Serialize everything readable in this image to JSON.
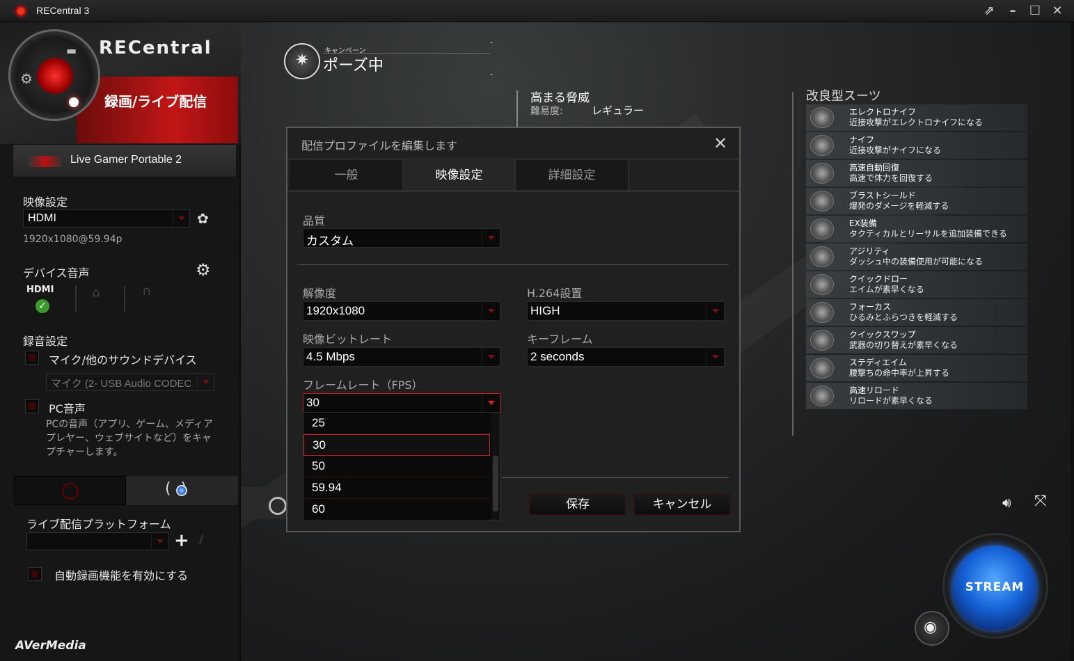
{
  "window": {
    "title": "RECentral 3",
    "controls": [
      "pin-icon",
      "minimize-icon",
      "maximize-icon",
      "close-icon"
    ]
  },
  "brand": {
    "logo_text": "RECentral",
    "mode": "録画/ライブ配信",
    "footer_logo": "AVerMedia"
  },
  "device": {
    "name": "Live Gamer Portable 2"
  },
  "video_settings": {
    "label": "映像設定",
    "source": "HDMI",
    "signal": "1920x1080@59.94p"
  },
  "device_audio": {
    "label": "デバイス音声",
    "sources": [
      {
        "label": "HDMI",
        "status": "check"
      }
    ]
  },
  "recording": {
    "label": "録音設定",
    "mic_label": "マイク/他のサウンドデバイス",
    "mic_device": "マイク (2- USB Audio CODEC",
    "pc_label": "PC音声",
    "pc_desc": "PCの音声（アプリ、ゲーム、メディアプレヤー、ウェブサイトなど）をキャプチャーします。"
  },
  "live": {
    "platform_label": "ライブ配信プラットフォーム",
    "platform_value": "",
    "auto_record_label": "自動録画機能を有効にする"
  },
  "game": {
    "pause_sub": "キャンペーン",
    "pause_title": "ポーズ中",
    "threat_title": "高まる脅威",
    "difficulty_label": "難易度:",
    "difficulty_value": "レギュラー",
    "suits_title": "改良型スーツ",
    "suits": [
      {
        "name": "エレクトロナイフ",
        "desc": "近接攻撃がエレクトロナイフになる"
      },
      {
        "name": "ナイフ",
        "desc": "近接攻撃がナイフになる"
      },
      {
        "name": "高速自動回復",
        "desc": "高速で体力を回復する"
      },
      {
        "name": "ブラストシールド",
        "desc": "爆発のダメージを軽減する"
      },
      {
        "name": "EX装備",
        "desc": "タクティカルとリーサルを追加装備できる"
      },
      {
        "name": "アジリティ",
        "desc": "ダッシュ中の装備使用が可能になる"
      },
      {
        "name": "クイックドロー",
        "desc": "エイムが素早くなる"
      },
      {
        "name": "フォーカス",
        "desc": "ひるみとふらつきを軽減する"
      },
      {
        "name": "クイックスワップ",
        "desc": "武器の切り替えが素早くなる"
      },
      {
        "name": "ステディエイム",
        "desc": "腰撃ちの命中率が上昇する"
      },
      {
        "name": "高速リロード",
        "desc": "リロードが素早くなる"
      }
    ]
  },
  "stream_button": {
    "label": "STREAM"
  },
  "dialog": {
    "title": "配信プロファイルを編集します",
    "tabs": [
      "一般",
      "映像設定",
      "詳細設定"
    ],
    "active_tab": "映像設定",
    "quality_label": "品質",
    "quality_value": "カスタム",
    "resolution_label": "解像度",
    "resolution_value": "1920x1080",
    "h264_label": "H.264設置",
    "h264_value": "HIGH",
    "bitrate_label": "映像ビットレート",
    "bitrate_value": "4.5 Mbps",
    "keyframe_label": "キーフレーム",
    "keyframe_value": "2 seconds",
    "fps_label": "フレームレート（FPS）",
    "fps_value": "30",
    "fps_options": [
      "25",
      "30",
      "50",
      "59.94",
      "60"
    ],
    "save_label": "保存",
    "cancel_label": "キャンセル"
  }
}
